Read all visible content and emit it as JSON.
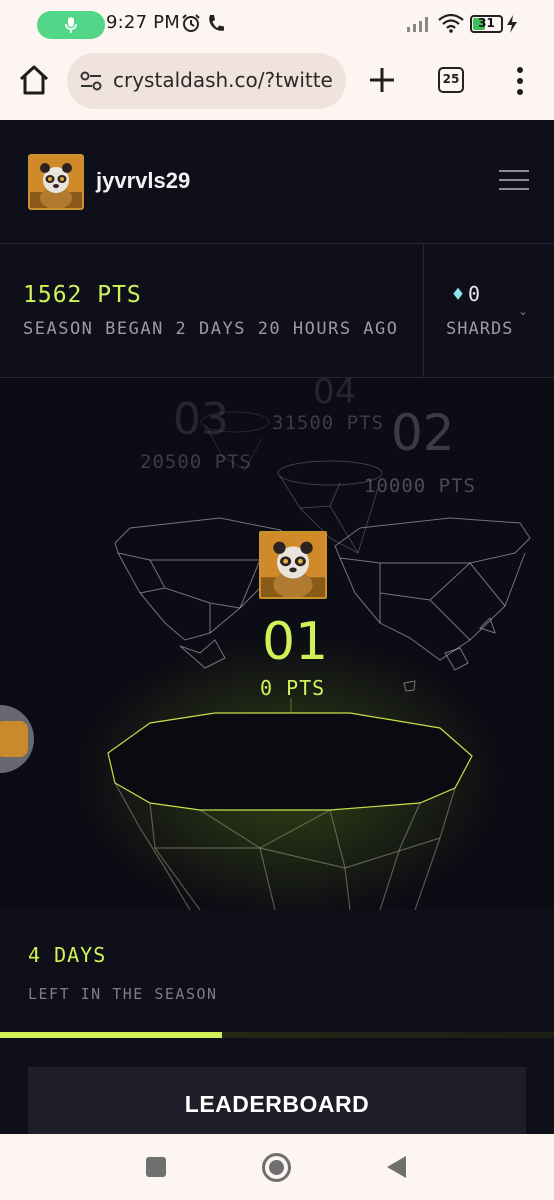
{
  "status_bar": {
    "time": "9:27 PM",
    "battery": "31",
    "icons": [
      "mic-icon",
      "alarm-icon",
      "phone-icon",
      "signal-icon",
      "wifi-icon",
      "battery-icon",
      "charging-icon"
    ]
  },
  "browser": {
    "url": "crystaldash.co/?twitte",
    "tab_count": "25",
    "icons": [
      "home-icon",
      "site-settings-icon",
      "plus-icon",
      "tabs-icon",
      "more-menu-icon"
    ]
  },
  "header": {
    "username": "jyvrvls29",
    "icons": [
      "avatar-panda",
      "hamburger-menu-icon"
    ]
  },
  "stats": {
    "points": "1562 PTS",
    "season_text": "SEASON BEGAN 2 DAYS 20 HOURS AGO",
    "shards_count": "0",
    "shards_label": "SHARDS",
    "gem_glyph": "♦",
    "chevron": "⌄"
  },
  "podium": {
    "rank_04": {
      "num": "04",
      "pts": "31500 PTS"
    },
    "rank_03": {
      "num": "03",
      "pts": "20500 PTS"
    },
    "rank_02": {
      "num": "02",
      "pts": "10000 PTS"
    },
    "rank_01": {
      "num": "01",
      "pts": "0 PTS"
    }
  },
  "season_left": {
    "days": "4 DAYS",
    "label": "LEFT IN THE SEASON",
    "progress_fraction": 0.4
  },
  "leaderboard_button": "LEADERBOARD",
  "colors": {
    "accent": "#d2f05a",
    "page_bg": "#0f0f1a",
    "button_bg": "#1e1e2a"
  }
}
